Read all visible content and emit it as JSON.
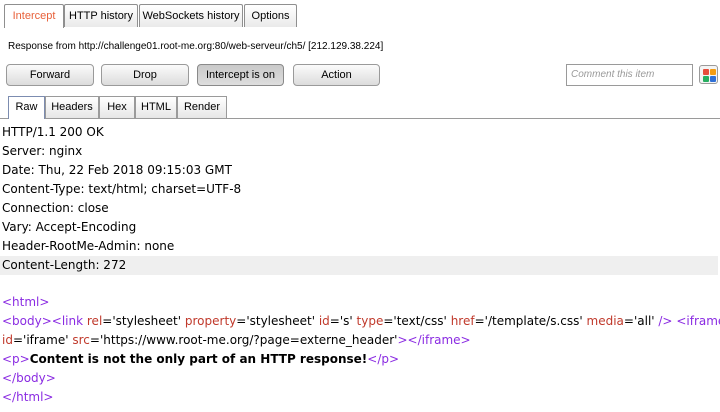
{
  "top_tabs": [
    "Intercept",
    "HTTP history",
    "WebSockets history",
    "Options"
  ],
  "response_line": "Response from http://challenge01.root-me.org:80/web-serveur/ch5/  [212.129.38.224]",
  "buttons": {
    "forward": "Forward",
    "drop": "Drop",
    "intercept": "Intercept is on",
    "action": "Action"
  },
  "comment": {
    "placeholder": "Comment this item"
  },
  "view_tabs": [
    "Raw",
    "Headers",
    "Hex",
    "HTML",
    "Render"
  ],
  "headers": [
    "HTTP/1.1 200 OK",
    "Server: nginx",
    "Date: Thu, 22 Feb 2018 09:15:03 GMT",
    "Content-Type: text/html; charset=UTF-8",
    "Connection: close",
    "Vary: Accept-Encoding",
    "Header-RootMe-Admin: none",
    "Content-Length: 272"
  ],
  "body_code": {
    "html_open": "<html>",
    "body_open": "<body>",
    "link_open": "<link ",
    "rel_attr": "rel",
    "rel_val": "'stylesheet'",
    "property_attr": "property",
    "property_val": "'stylesheet'",
    "id_attr": "id",
    "id_val": "'s'",
    "type_attr": "type",
    "type_val": "'text/css'",
    "href_attr": "href",
    "href_val": "'/template/s.css'",
    "media_attr": "media",
    "media_val": "'all'",
    "link_close": " />",
    "iframe_open": "<iframe",
    "iframe_id_attr": "id",
    "iframe_id_val": "'iframe'",
    "src_attr": "src",
    "src_val": "'https://www.root-me.org/?page=externe_header'",
    "iframe_gt": ">",
    "iframe_close": "</iframe>",
    "p_open": "<p>",
    "p_text": "Content is not the only part of an HTTP response!",
    "p_close": "</p>",
    "body_close": "</body>",
    "html_close": "</html>"
  },
  "colors": {
    "active_tab_text": "#e8613a",
    "tag": "#8a2be2",
    "attr": "#c0392b",
    "highlight_row": "#efefef"
  }
}
